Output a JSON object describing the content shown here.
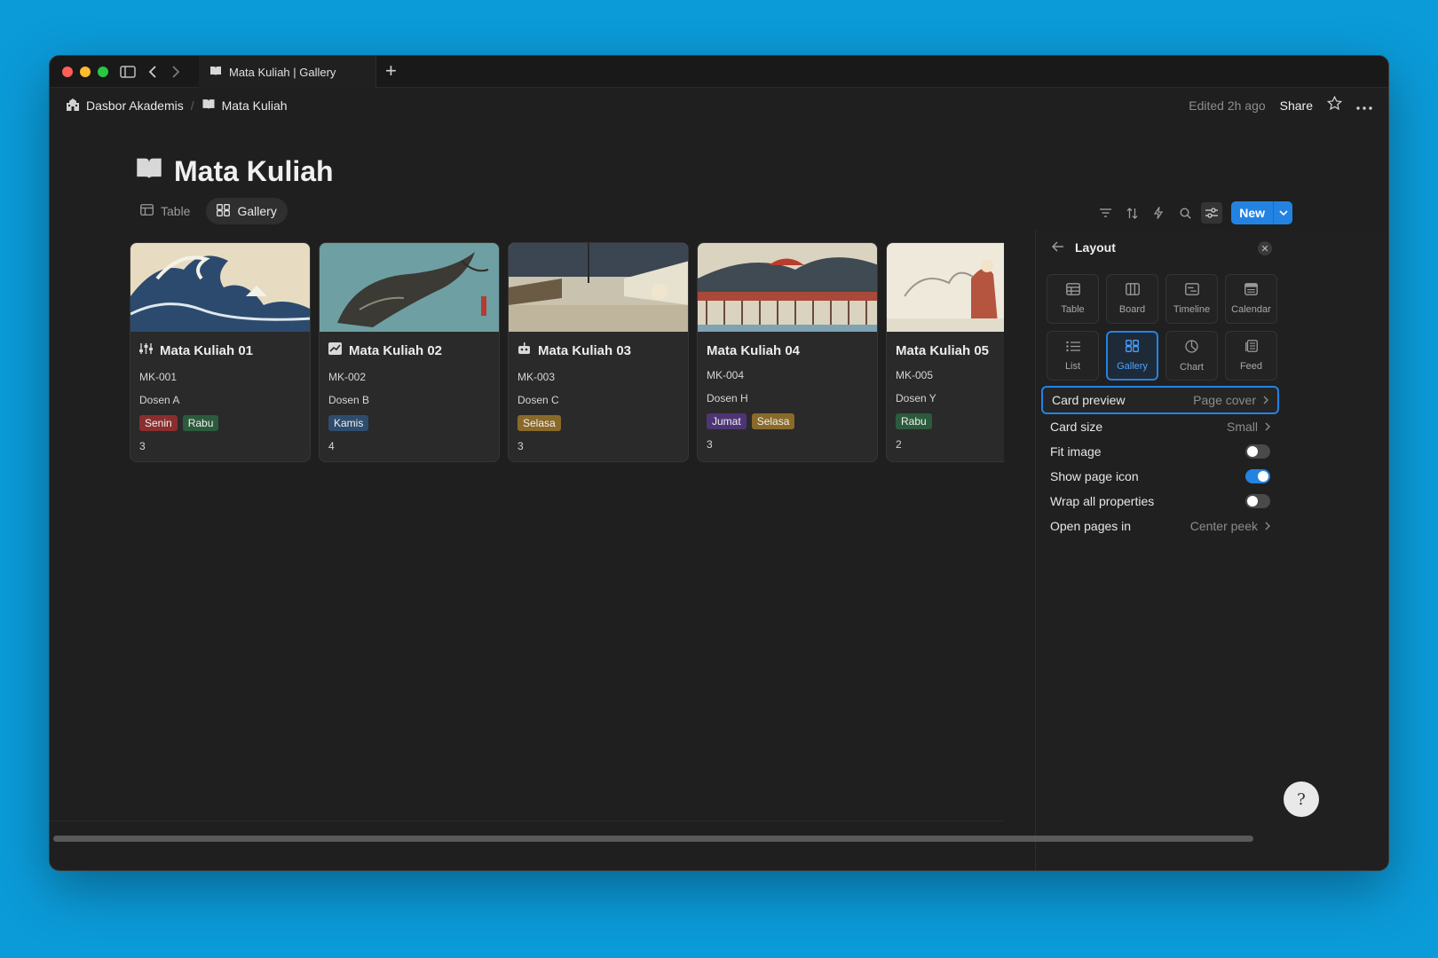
{
  "window": {
    "tab_title": "Mata Kuliah | Gallery",
    "new_tab": "+"
  },
  "breadcrumb": {
    "parent": "Dasbor Akademis",
    "current": "Mata Kuliah"
  },
  "topbar": {
    "edited": "Edited 2h ago",
    "share": "Share"
  },
  "page": {
    "title": "Mata Kuliah"
  },
  "views": [
    {
      "label": "Table",
      "icon": "table-icon"
    },
    {
      "label": "Gallery",
      "icon": "gallery-icon"
    }
  ],
  "toolbar": {
    "new_label": "New"
  },
  "cards": [
    {
      "title": "Mata Kuliah 01",
      "code": "MK-001",
      "lecturer": "Dosen A",
      "tags": [
        {
          "label": "Senin",
          "color": "#8a2e2e"
        },
        {
          "label": "Rabu",
          "color": "#2c5a3c"
        }
      ],
      "count": "3",
      "icon": "sliders-icon",
      "cover": "wave"
    },
    {
      "title": "Mata Kuliah 02",
      "code": "MK-002",
      "lecturer": "Dosen B",
      "tags": [
        {
          "label": "Kamis",
          "color": "#2e4d6e"
        }
      ],
      "count": "4",
      "icon": "chart-icon",
      "cover": "koi"
    },
    {
      "title": "Mata Kuliah 03",
      "code": "MK-003",
      "lecturer": "Dosen C",
      "tags": [
        {
          "label": "Selasa",
          "color": "#8a6a2a"
        }
      ],
      "count": "3",
      "icon": "robot-icon",
      "cover": "street"
    },
    {
      "title": "Mata Kuliah 04",
      "code": "MK-004",
      "lecturer": "Dosen H",
      "tags": [
        {
          "label": "Jumat",
          "color": "#4d3575"
        },
        {
          "label": "Selasa",
          "color": "#8a6a2a"
        }
      ],
      "count": "3",
      "icon": "",
      "cover": "bridge"
    },
    {
      "title": "Mata Kuliah 05",
      "code": "MK-005",
      "lecturer": "Dosen Y",
      "tags": [
        {
          "label": "Rabu",
          "color": "#2c5a3c"
        }
      ],
      "count": "2",
      "icon": "",
      "cover": "snow"
    }
  ],
  "panel": {
    "title": "Layout",
    "layouts": [
      {
        "label": "Table",
        "icon": "table-icon"
      },
      {
        "label": "Board",
        "icon": "board-icon"
      },
      {
        "label": "Timeline",
        "icon": "timeline-icon"
      },
      {
        "label": "Calendar",
        "icon": "calendar-icon"
      },
      {
        "label": "List",
        "icon": "list-icon"
      },
      {
        "label": "Gallery",
        "icon": "gallery-icon"
      },
      {
        "label": "Chart",
        "icon": "chart-pie-icon"
      },
      {
        "label": "Feed",
        "icon": "feed-icon"
      }
    ],
    "selected_layout": "Gallery",
    "settings": [
      {
        "label": "Card preview",
        "value": "Page cover"
      },
      {
        "label": "Card size",
        "value": "Small"
      },
      {
        "label": "Fit image",
        "toggle": false
      },
      {
        "label": "Show page icon",
        "toggle": true
      },
      {
        "label": "Wrap all properties",
        "toggle": false
      },
      {
        "label": "Open pages in",
        "value": "Center peek"
      }
    ]
  },
  "colors": {
    "accent": "#2383e2",
    "background": "#1f1f1f"
  }
}
